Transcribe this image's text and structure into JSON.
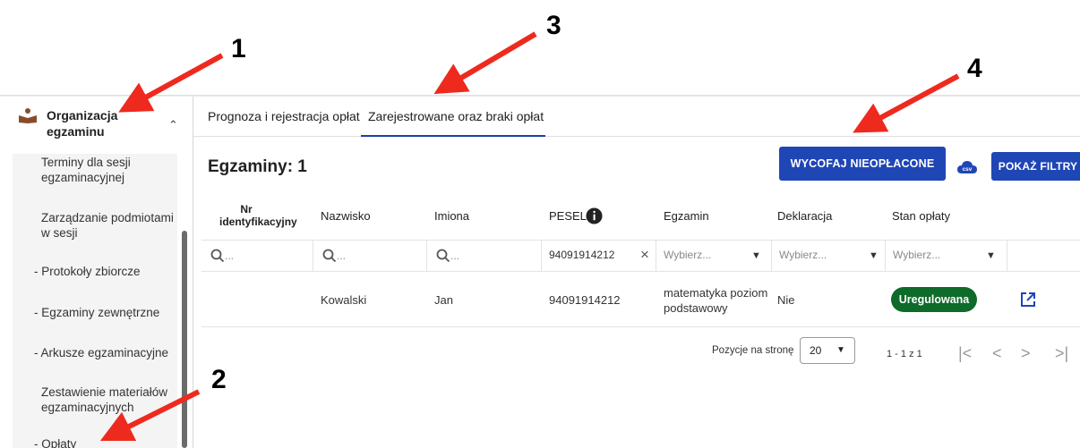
{
  "annotations": {
    "n1": "1",
    "n2": "2",
    "n3": "3",
    "n4": "4",
    "arrow_color": "#ee2a1f"
  },
  "sidebar": {
    "section_title": "Organizacja egzaminu",
    "section_icon": "reading-person-icon",
    "items": [
      {
        "label": "Terminy dla sesji egzaminacyjnej"
      },
      {
        "label": "Zarządzanie podmiotami w sesji"
      },
      {
        "label": "- Protokoły zbiorcze"
      },
      {
        "label": "- Egzaminy zewnętrzne"
      },
      {
        "label": "- Arkusze egzaminacyjne"
      },
      {
        "label": "Zestawienie materiałów egzaminacyjnych"
      },
      {
        "label": "- Opłaty"
      }
    ]
  },
  "tabs": [
    {
      "label": "Prognoza i rejestracja opłat"
    },
    {
      "label": "Zarejestrowane oraz braki opłat",
      "active": true
    }
  ],
  "main": {
    "heading": "Egzaminy: 1",
    "withdraw_button": "WYCOFAJ NIEOPŁACONE",
    "csv_label": "csv",
    "filters_button": "POKAŻ FILTRY"
  },
  "table": {
    "headers": [
      "Nr identyfikacyjny",
      "Nazwisko",
      "Imiona",
      "PESEL",
      "Egzamin",
      "Deklaracja",
      "Stan opłaty"
    ],
    "filters": {
      "text_placeholder": "...",
      "pesel_value": "94091914212",
      "select_placeholder": "Wybierz..."
    },
    "rows": [
      {
        "id": "",
        "surname": "Kowalski",
        "names": "Jan",
        "pesel": "94091914212",
        "exam": "matematyka poziom podstawowy",
        "declaration": "Nie",
        "status": "Uregulowana"
      }
    ]
  },
  "pagination": {
    "per_page_label": "Pozycje na stronę",
    "per_page_value": "20",
    "range": "1 - 1 z 1"
  },
  "colors": {
    "primary": "#1f46b5",
    "status_ok": "#0e6b2a"
  }
}
